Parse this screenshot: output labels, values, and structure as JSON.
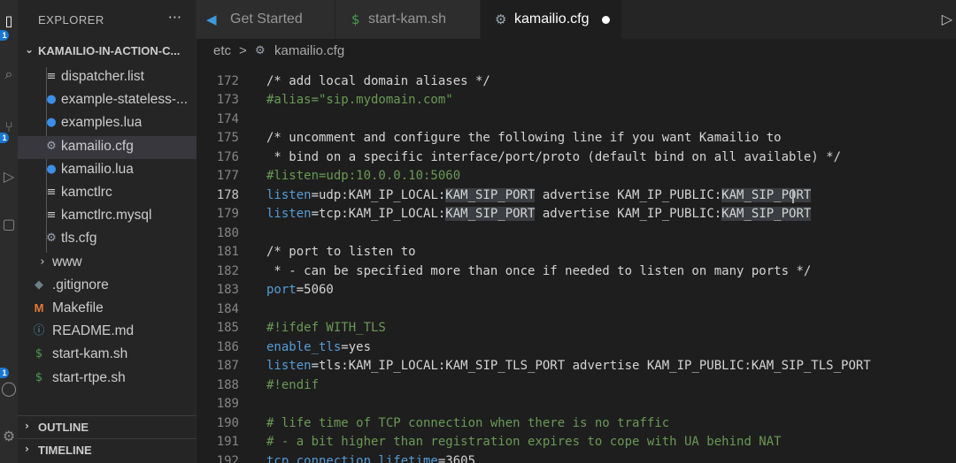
{
  "sidebar": {
    "title": "EXPLORER",
    "more": "···",
    "root": "KAMAILIO-IN-ACTION-C...",
    "items": [
      {
        "label": "dispatcher.list",
        "icon": "≡",
        "color": "#c5c5c5"
      },
      {
        "label": "example-stateless-...",
        "icon": "●",
        "color": "#3b8eea"
      },
      {
        "label": "examples.lua",
        "icon": "●",
        "color": "#3b8eea"
      },
      {
        "label": "kamailio.cfg",
        "icon": "⚙",
        "color": "#9da5b4"
      },
      {
        "label": "kamailio.lua",
        "icon": "●",
        "color": "#3b8eea"
      },
      {
        "label": "kamctlrc",
        "icon": "≡",
        "color": "#c5c5c5"
      },
      {
        "label": "kamctlrc.mysql",
        "icon": "≡",
        "color": "#c5c5c5"
      },
      {
        "label": "tls.cfg",
        "icon": "⚙",
        "color": "#9da5b4"
      },
      {
        "label": "www",
        "icon": "›",
        "color": "#cccccc"
      },
      {
        "label": ".gitignore",
        "icon": "◆",
        "color": "#6d8086"
      },
      {
        "label": "Makefile",
        "icon": "M",
        "color": "#e37933"
      },
      {
        "label": "README.md",
        "icon": "ⓘ",
        "color": "#519aba"
      },
      {
        "label": "start-kam.sh",
        "icon": "$",
        "color": "#4d9e4d"
      },
      {
        "label": "start-rtpe.sh",
        "icon": "$",
        "color": "#4d9e4d"
      }
    ],
    "outline": "OUTLINE",
    "timeline": "TIMELINE"
  },
  "tabs": [
    {
      "label": "Get Started",
      "icon": "◀",
      "icon_color": "#3c99dc"
    },
    {
      "label": "start-kam.sh",
      "icon": "$",
      "icon_color": "#4d9e4d"
    },
    {
      "label": "kamailio.cfg",
      "icon": "⚙",
      "icon_color": "#9da5b4"
    }
  ],
  "breadcrumb": {
    "folder": "etc",
    "sep": ">",
    "file": "kamailio.cfg"
  },
  "editor": {
    "current_line": 178,
    "partial_top_line": "171",
    "lines": [
      {
        "n": "172",
        "segs": [
          [
            "/* add local domain aliases */",
            "c-comment"
          ]
        ]
      },
      {
        "n": "173",
        "segs": [
          [
            "#alias=\"sip.mydomain.com\"",
            "c-green"
          ]
        ]
      },
      {
        "n": "174",
        "segs": []
      },
      {
        "n": "175",
        "segs": [
          [
            "/* uncomment and configure the following line if you want Kamailio to",
            "c-comment"
          ]
        ]
      },
      {
        "n": "176",
        "segs": [
          [
            " * bind on a specific interface/port/proto (default bind on all available) */",
            "c-comment"
          ]
        ]
      },
      {
        "n": "177",
        "segs": [
          [
            "#listen=udp:10.0.0.10:5060",
            "c-green"
          ]
        ]
      },
      {
        "n": "178",
        "segs": [
          [
            "listen",
            "c-key"
          ],
          [
            "=udp:KAM_IP_LOCAL:",
            ""
          ],
          [
            "KAM_SIP_PORT",
            "c-hl"
          ],
          [
            " advertise KAM_IP_PUBLIC:",
            ""
          ],
          [
            "KAM_SIP_PORT",
            "c-hl"
          ]
        ]
      },
      {
        "n": "179",
        "segs": [
          [
            "listen",
            "c-key"
          ],
          [
            "=tcp:KAM_IP_LOCAL:",
            ""
          ],
          [
            "KAM_SIP_PORT",
            "c-hl"
          ],
          [
            " advertise KAM_IP_PUBLIC:",
            ""
          ],
          [
            "KAM_SIP_PORT",
            "c-hl"
          ]
        ]
      },
      {
        "n": "180",
        "segs": []
      },
      {
        "n": "181",
        "segs": [
          [
            "/* port to listen to",
            "c-comment"
          ]
        ]
      },
      {
        "n": "182",
        "segs": [
          [
            " * - can be specified more than once if needed to listen on many ports */",
            "c-comment"
          ]
        ]
      },
      {
        "n": "183",
        "segs": [
          [
            "port",
            "c-key"
          ],
          [
            "=5060",
            ""
          ]
        ]
      },
      {
        "n": "184",
        "segs": []
      },
      {
        "n": "185",
        "segs": [
          [
            "#!ifdef WITH_TLS",
            "c-green"
          ]
        ]
      },
      {
        "n": "186",
        "segs": [
          [
            "enable_tls",
            "c-key"
          ],
          [
            "=yes",
            ""
          ]
        ]
      },
      {
        "n": "187",
        "segs": [
          [
            "listen",
            "c-key"
          ],
          [
            "=tls:KAM_IP_LOCAL:KAM_SIP_TLS_PORT advertise KAM_IP_PUBLIC:KAM_SIP_TLS_PORT",
            ""
          ]
        ]
      },
      {
        "n": "188",
        "segs": [
          [
            "#!endif",
            "c-green"
          ]
        ]
      },
      {
        "n": "189",
        "segs": []
      },
      {
        "n": "190",
        "segs": [
          [
            "# life time of TCP connection when there is no traffic",
            "c-green"
          ]
        ]
      },
      {
        "n": "191",
        "segs": [
          [
            "# - a bit higher than registration expires to cope with UA behind NAT",
            "c-green"
          ]
        ]
      },
      {
        "n": "192",
        "segs": [
          [
            "tcp_connection_lifetime",
            "c-key"
          ],
          [
            "=3605",
            ""
          ]
        ]
      }
    ]
  },
  "activity": {
    "icons": [
      "files-icon",
      "search-icon",
      "source-control-icon",
      "run-debug-icon",
      "extensions-icon",
      "account-icon",
      "settings-icon"
    ],
    "badge": "1"
  }
}
